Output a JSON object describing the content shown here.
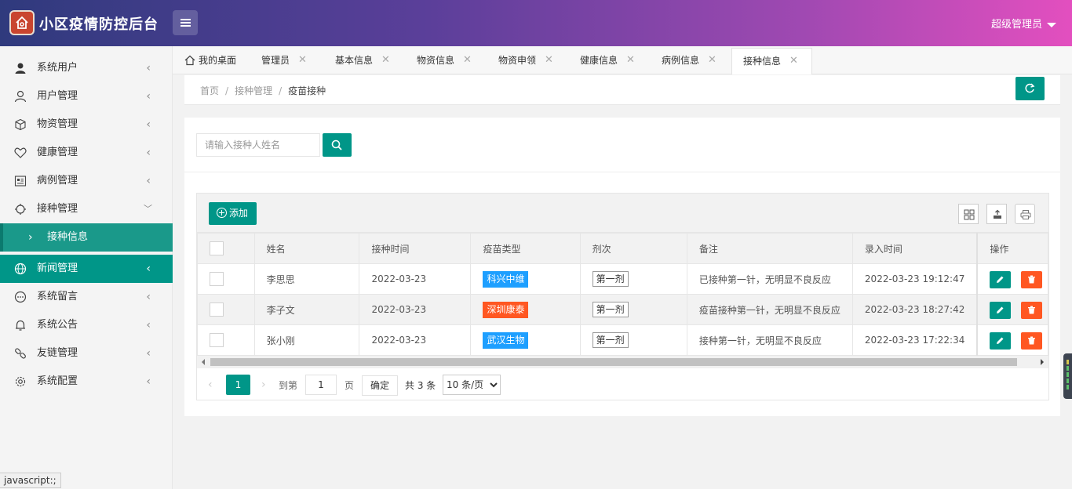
{
  "header": {
    "app_title": "小区疫情防控后台",
    "user_menu": "超级管理员",
    "gradient": [
      "#2f3a7d",
      "#e34fbf"
    ]
  },
  "sidebar": {
    "items": [
      {
        "label": "系统用户",
        "icon": "user-icon"
      },
      {
        "label": "用户管理",
        "icon": "person-outline-icon"
      },
      {
        "label": "物资管理",
        "icon": "box-icon"
      },
      {
        "label": "健康管理",
        "icon": "heart-icon"
      },
      {
        "label": "病例管理",
        "icon": "record-icon"
      },
      {
        "label": "接种管理",
        "icon": "vaccine-icon",
        "expanded": true
      },
      {
        "label": "接种信息",
        "submenu": true
      },
      {
        "label": "新闻管理",
        "icon": "globe-icon",
        "active": true
      },
      {
        "label": "系统留言",
        "icon": "message-icon"
      },
      {
        "label": "系统公告",
        "icon": "bell-icon"
      },
      {
        "label": "友链管理",
        "icon": "link-icon"
      },
      {
        "label": "系统配置",
        "icon": "gear-icon"
      }
    ]
  },
  "tabs": [
    {
      "label": "我的桌面",
      "icon": "home-icon"
    },
    {
      "label": "管理员"
    },
    {
      "label": "基本信息"
    },
    {
      "label": "物资信息"
    },
    {
      "label": "物资申领"
    },
    {
      "label": "健康信息"
    },
    {
      "label": "病例信息"
    },
    {
      "label": "接种信息",
      "active": true
    }
  ],
  "breadcrumb": [
    "首页",
    "接种管理",
    "疫苗接种"
  ],
  "search": {
    "placeholder": "请输入接种人姓名",
    "value": ""
  },
  "toolbar": {
    "add_label": "添加"
  },
  "table": {
    "columns": [
      "姓名",
      "接种时间",
      "疫苗类型",
      "剂次",
      "备注",
      "录入时间",
      "操作"
    ],
    "rows": [
      {
        "name": "李思思",
        "date": "2022-03-23",
        "vaccine": "科兴中维",
        "vaccine_color": "#1e9fff",
        "dose": "第一剂",
        "note": "已接种第一针，无明显不良反应",
        "created": "2022-03-23 19:12:47"
      },
      {
        "name": "李子文",
        "date": "2022-03-23",
        "vaccine": "深圳康泰",
        "vaccine_color": "#ff5722",
        "dose": "第一剂",
        "note": "疫苗接种第一针，无明显不良反应",
        "created": "2022-03-23 18:27:42"
      },
      {
        "name": "张小刚",
        "date": "2022-03-23",
        "vaccine": "武汉生物",
        "vaccine_color": "#1e9fff",
        "dose": "第一剂",
        "note": "接种第一针，无明显不良反应",
        "created": "2022-03-23 17:22:34"
      }
    ]
  },
  "pager": {
    "current": "1",
    "goto_label": "到第",
    "goto_value": "1",
    "page_label": "页",
    "ok_label": "确定",
    "total": "共 3 条",
    "size_option": "10 条/页"
  },
  "status_text": "javascript:;",
  "colors": {
    "primary": "#009688",
    "danger": "#ff5722",
    "info": "#1e9fff"
  }
}
